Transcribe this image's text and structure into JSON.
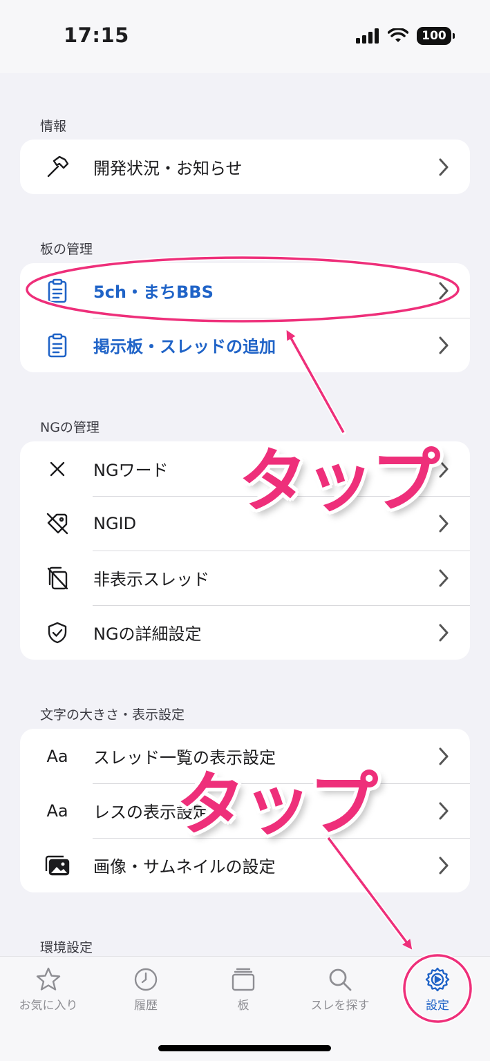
{
  "status": {
    "time": "17:15",
    "battery": "100"
  },
  "sections": {
    "info": {
      "header": "情報",
      "items": [
        {
          "label": "開発状況・お知らせ",
          "icon": "hammer-icon"
        }
      ]
    },
    "board": {
      "header": "板の管理",
      "items": [
        {
          "label": "5ch・まちBBS",
          "icon": "clipboard-icon"
        },
        {
          "label": "掲示板・スレッドの追加",
          "icon": "clipboard-icon"
        }
      ]
    },
    "ng": {
      "header": "NGの管理",
      "items": [
        {
          "label": "NGワード",
          "icon": "cross-icon"
        },
        {
          "label": "NGID",
          "icon": "tag-slash-icon"
        },
        {
          "label": "非表示スレッド",
          "icon": "copy-slash-icon"
        },
        {
          "label": "NGの詳細設定",
          "icon": "shield-check-icon"
        }
      ]
    },
    "display": {
      "header": "文字の大きさ・表示設定",
      "items": [
        {
          "label": "スレッド一覧の表示設定",
          "icon_text": "Aa"
        },
        {
          "label": "レスの表示設定",
          "icon_text": "Aa"
        },
        {
          "label": "画像・サムネイルの設定",
          "icon": "photos-icon"
        }
      ]
    },
    "env": {
      "header": "環境設定"
    }
  },
  "tabbar": {
    "tabs": [
      {
        "label": "お気に入り",
        "icon": "star-icon"
      },
      {
        "label": "履歴",
        "icon": "clock-icon"
      },
      {
        "label": "板",
        "icon": "stack-icon"
      },
      {
        "label": "スレを探す",
        "icon": "search-icon"
      },
      {
        "label": "設定",
        "icon": "gear-icon",
        "active": true
      }
    ]
  },
  "annotations": {
    "tap1": "タップ",
    "tap2": "タップ"
  },
  "colors": {
    "accent": "#1f63c7",
    "annotation": "#ee2f7a",
    "background": "#f2f2f7"
  }
}
